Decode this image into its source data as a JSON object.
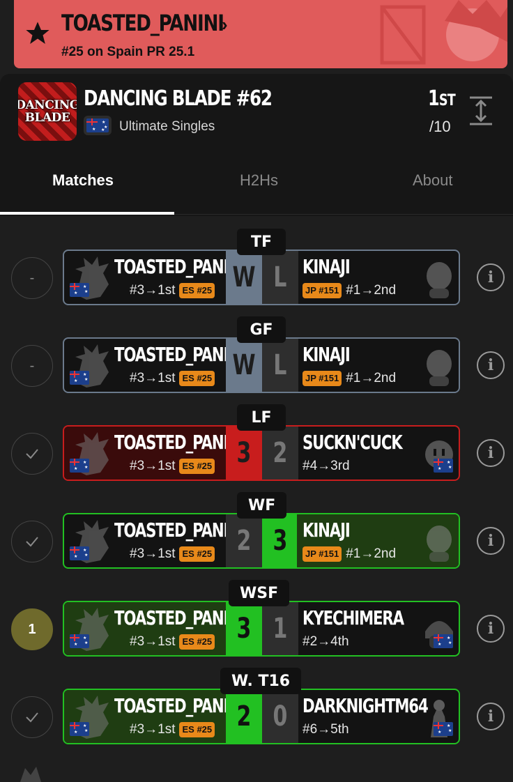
{
  "banner": {
    "player_name": "TOASTED_PANINI",
    "rank_text": "#25 on Spain PR 25.1",
    "color": "#e05b5b",
    "icon": "star-icon"
  },
  "tournament": {
    "name": "DANCING BLADE #62",
    "logo_line1": "DANCING",
    "logo_line2": "BLADE",
    "game": "Ultimate Singles",
    "placement": "1",
    "placement_suffix": "ST",
    "total": "/10"
  },
  "tabs": [
    {
      "label": "Matches"
    },
    {
      "label": "H2Hs"
    },
    {
      "label": "About"
    }
  ],
  "matches": [
    {
      "round": "TF",
      "status": "-",
      "left": {
        "name": "TOASTED_PANI...",
        "seed": "#3→1st",
        "badge": "ES #25",
        "score": "W"
      },
      "right": {
        "name": "KINAJI",
        "seed": "#1→2nd",
        "badge": "JP #151",
        "score": "L"
      }
    },
    {
      "round": "GF",
      "status": "-",
      "left": {
        "name": "TOASTED_PANI...",
        "seed": "#3→1st",
        "badge": "ES #25",
        "score": "W"
      },
      "right": {
        "name": "KINAJI",
        "seed": "#1→2nd",
        "badge": "JP #151",
        "score": "L"
      }
    },
    {
      "round": "LF",
      "status": "✓",
      "left": {
        "name": "TOASTED_PANI...",
        "seed": "#3→1st",
        "badge": "ES #25",
        "score": "3"
      },
      "right": {
        "name": "SUCKN'CUCK",
        "seed": "#4→3rd",
        "badge": "",
        "score": "2"
      }
    },
    {
      "round": "WF",
      "status": "✓",
      "left": {
        "name": "TOASTED_PANI...",
        "seed": "#3→1st",
        "badge": "ES #25",
        "score": "2"
      },
      "right": {
        "name": "KINAJI",
        "seed": "#1→2nd",
        "badge": "JP #151",
        "score": "3"
      }
    },
    {
      "round": "WSF",
      "status": "1",
      "left": {
        "name": "TOASTED_PANI...",
        "seed": "#3→1st",
        "badge": "ES #25",
        "score": "3"
      },
      "right": {
        "name": "KYECHIMERA",
        "seed": "#2→4th",
        "badge": "",
        "score": "1"
      }
    },
    {
      "round": "W. T16",
      "status": "✓",
      "left": {
        "name": "TOASTED_PANI...",
        "seed": "#3→1st",
        "badge": "ES #25",
        "score": "2"
      },
      "right": {
        "name": "DARKNIGHTM64",
        "seed": "#6→5th",
        "badge": "",
        "score": "0"
      }
    }
  ],
  "colors": {
    "win_green": "#22c022",
    "win_bg_green": "#1f3d12",
    "loss_red": "#c81d1d",
    "loss_bg_red": "#3a0b0b",
    "badge_orange": "#e8891a",
    "neutral_grey": "#6b7a8c"
  }
}
